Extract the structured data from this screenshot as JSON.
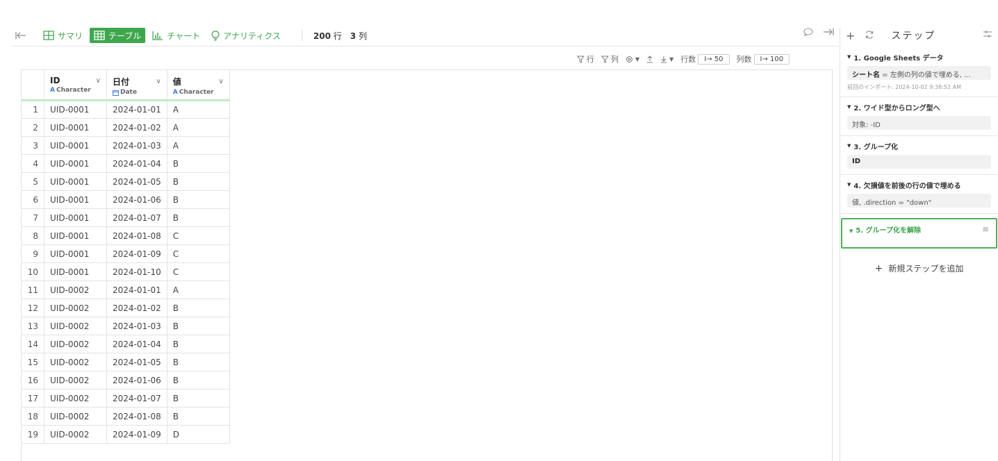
{
  "toolbar": {
    "tabs": [
      {
        "label": "サマリ",
        "icon": "grid-outline-icon"
      },
      {
        "label": "テーブル",
        "icon": "table-icon"
      },
      {
        "label": "チャート",
        "icon": "bar-chart-icon"
      },
      {
        "label": "アナリティクス",
        "icon": "lightbulb-icon"
      }
    ],
    "row_count": "200",
    "row_unit": "行",
    "col_count": "3",
    "col_unit": "列"
  },
  "grid_controls": {
    "row_filter": "行",
    "col_filter": "列",
    "rows_label": "行数",
    "rows_value": "I→ 50",
    "cols_label": "列数",
    "cols_value": "I→ 100"
  },
  "columns": [
    {
      "name": "ID",
      "type": "Character",
      "type_icon": "A"
    },
    {
      "name": "日付",
      "type": "Date",
      "type_icon": "calendar-icon"
    },
    {
      "name": "値",
      "type": "Character",
      "type_icon": "A"
    }
  ],
  "rows": [
    [
      "1",
      "UID-0001",
      "2024-01-01",
      "A"
    ],
    [
      "2",
      "UID-0001",
      "2024-01-02",
      "A"
    ],
    [
      "3",
      "UID-0001",
      "2024-01-03",
      "A"
    ],
    [
      "4",
      "UID-0001",
      "2024-01-04",
      "B"
    ],
    [
      "5",
      "UID-0001",
      "2024-01-05",
      "B"
    ],
    [
      "6",
      "UID-0001",
      "2024-01-06",
      "B"
    ],
    [
      "7",
      "UID-0001",
      "2024-01-07",
      "B"
    ],
    [
      "8",
      "UID-0001",
      "2024-01-08",
      "C"
    ],
    [
      "9",
      "UID-0001",
      "2024-01-09",
      "C"
    ],
    [
      "10",
      "UID-0001",
      "2024-01-10",
      "C"
    ],
    [
      "11",
      "UID-0002",
      "2024-01-01",
      "A"
    ],
    [
      "12",
      "UID-0002",
      "2024-01-02",
      "B"
    ],
    [
      "13",
      "UID-0002",
      "2024-01-03",
      "B"
    ],
    [
      "14",
      "UID-0002",
      "2024-01-04",
      "B"
    ],
    [
      "15",
      "UID-0002",
      "2024-01-05",
      "B"
    ],
    [
      "16",
      "UID-0002",
      "2024-01-06",
      "B"
    ],
    [
      "17",
      "UID-0002",
      "2024-01-07",
      "B"
    ],
    [
      "18",
      "UID-0002",
      "2024-01-08",
      "B"
    ],
    [
      "19",
      "UID-0002",
      "2024-01-09",
      "D"
    ]
  ],
  "steps_panel": {
    "title": "ステップ",
    "steps": [
      {
        "title": "1. Google Sheets データ",
        "param_key": "シート名",
        "param_value": " = 左側の列の値で埋める, ...",
        "note": "前回のインポート: 2024-10-02 9:38:52 AM"
      },
      {
        "title": "2. ワイド型からロング型へ",
        "param_key": "",
        "param_value": "対象: -ID"
      },
      {
        "title": "3. グループ化",
        "param_key": "",
        "param_value": "ID"
      },
      {
        "title": "4. 欠損値を前後の行の値で埋める",
        "param_key": "",
        "param_value": "値, .direction = \"down\""
      },
      {
        "title": "5. グループ化を解除"
      }
    ],
    "add_step": "新規ステップを追加"
  },
  "colors": {
    "accent": "#3ea74e",
    "header_underline": "#c4ecc6",
    "type_blue": "#3a7bd5"
  }
}
